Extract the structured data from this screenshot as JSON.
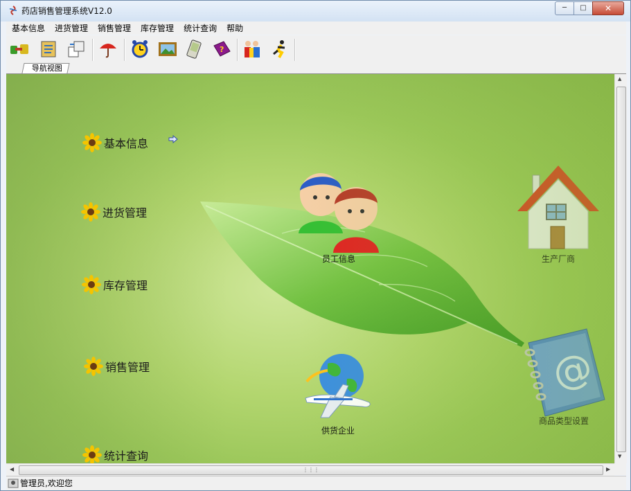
{
  "window": {
    "title": "药店销售管理系统V12.0"
  },
  "menu": [
    "基本信息",
    "进货管理",
    "销售管理",
    "库存管理",
    "统计查询",
    "帮助"
  ],
  "toolbar": {
    "buttons": [
      "connect-icon",
      "notebook-icon",
      "transfer-icon",
      "umbrella-icon",
      "alarm-clock-icon",
      "picture-icon",
      "pda-icon",
      "help-book-icon",
      "users-icon",
      "runner-icon"
    ]
  },
  "tab": {
    "label": "导航视图"
  },
  "navigation": {
    "items": [
      "基本信息",
      "进货管理",
      "库存管理",
      "销售管理",
      "统计查询"
    ]
  },
  "functions": {
    "employee": "员工信息",
    "manufacturer": "生产厂商",
    "supplier": "供货企业",
    "category": "商品类型设置"
  },
  "status": {
    "text": "管理员,欢迎您"
  },
  "colors": {
    "accent": "#6aa84f",
    "title_bar": "#d3e2f3",
    "close_button": "#c64b36"
  }
}
